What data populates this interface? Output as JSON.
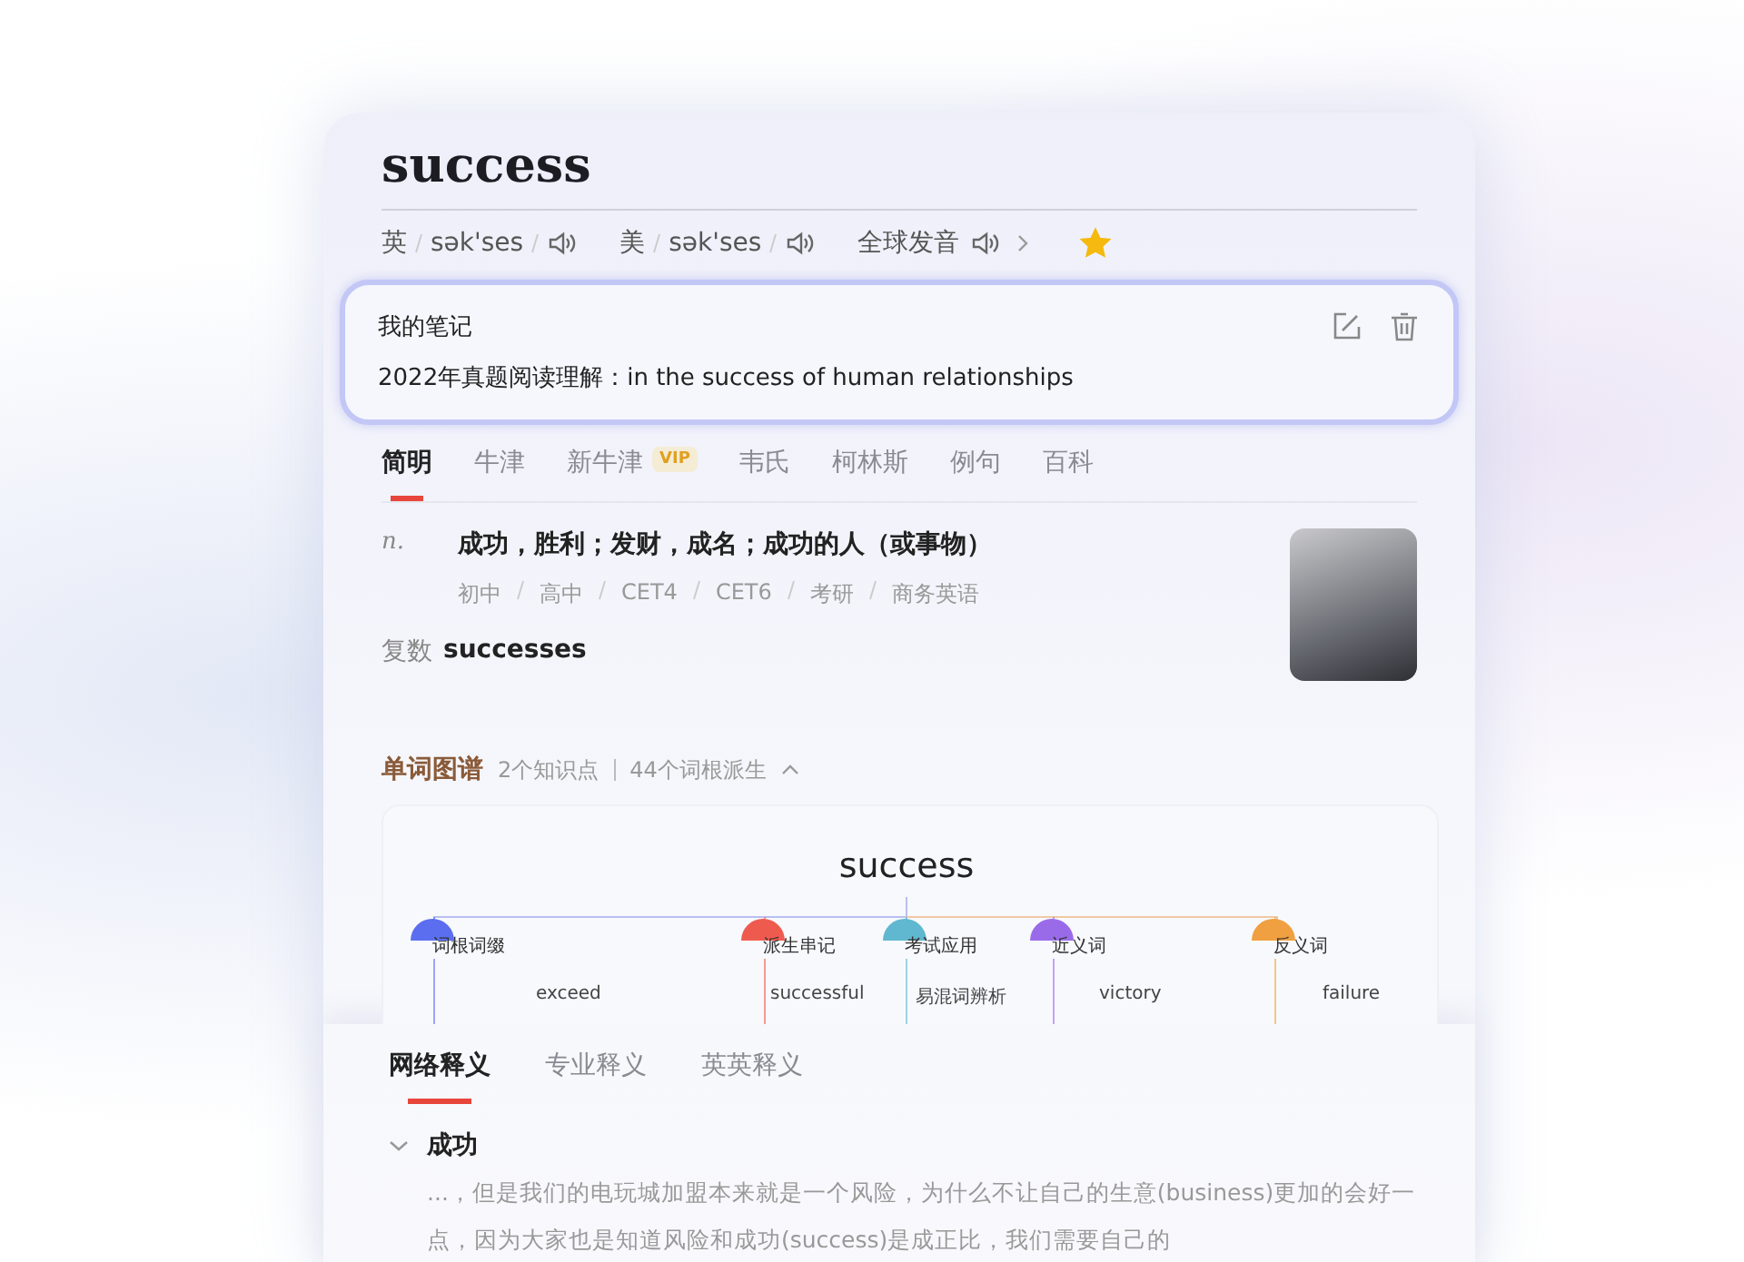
{
  "word": "success",
  "phonetics": [
    {
      "region": "英",
      "ipa": "sək'ses"
    },
    {
      "region": "美",
      "ipa": "sək'ses"
    }
  ],
  "global_pronunciation": "全球发音",
  "starred": true,
  "note": {
    "title": "我的笔记",
    "text": "2022年真题阅读理解：in the success of human relationships"
  },
  "dict_tabs": [
    {
      "label": "简明",
      "selected": true
    },
    {
      "label": "牛津",
      "selected": false
    },
    {
      "label": "新牛津",
      "selected": false,
      "badge": "VIP"
    },
    {
      "label": "韦氏",
      "selected": false
    },
    {
      "label": "柯林斯",
      "selected": false
    },
    {
      "label": "例句",
      "selected": false
    },
    {
      "label": "百科",
      "selected": false
    }
  ],
  "definition": {
    "pos": "n.",
    "meaning": "成功，胜利；发财，成名；成功的人（或事物）",
    "tags": [
      "初中",
      "高中",
      "CET4",
      "CET6",
      "考研",
      "商务英语"
    ],
    "plural_label": "复数",
    "plural": "successes"
  },
  "word_map": {
    "title": "单词图谱",
    "knowledge": "2个知识点",
    "derived": "44个词根派生",
    "center": "success",
    "branches": [
      {
        "label": "词根词缀",
        "color": "#5b6ef0",
        "leaves": [
          "exceed"
        ]
      },
      {
        "label": "派生串记",
        "color": "#ef5a4f",
        "leaves": [
          "successful"
        ]
      },
      {
        "label": "考试应用",
        "color": "#5fb8cf",
        "leaves": [
          "易混词辨析"
        ]
      },
      {
        "label": "近义词",
        "color": "#9a6be8",
        "leaves": [
          "victory"
        ]
      },
      {
        "label": "反义词",
        "color": "#f0a040",
        "leaves": [
          "failure"
        ]
      }
    ]
  },
  "net_tabs": [
    {
      "label": "网络释义",
      "selected": true
    },
    {
      "label": "专业释义",
      "selected": false
    },
    {
      "label": "英英释义",
      "selected": false
    }
  ],
  "senses": [
    {
      "heading": "成功",
      "expanded": true,
      "text": "...，但是我们的电玩城加盟本来就是一个风险，为什么不让自己的生意(business)更加的会好一点，因为大家也是知道风险和成功(success)是成正比，我们需要自己的"
    }
  ]
}
